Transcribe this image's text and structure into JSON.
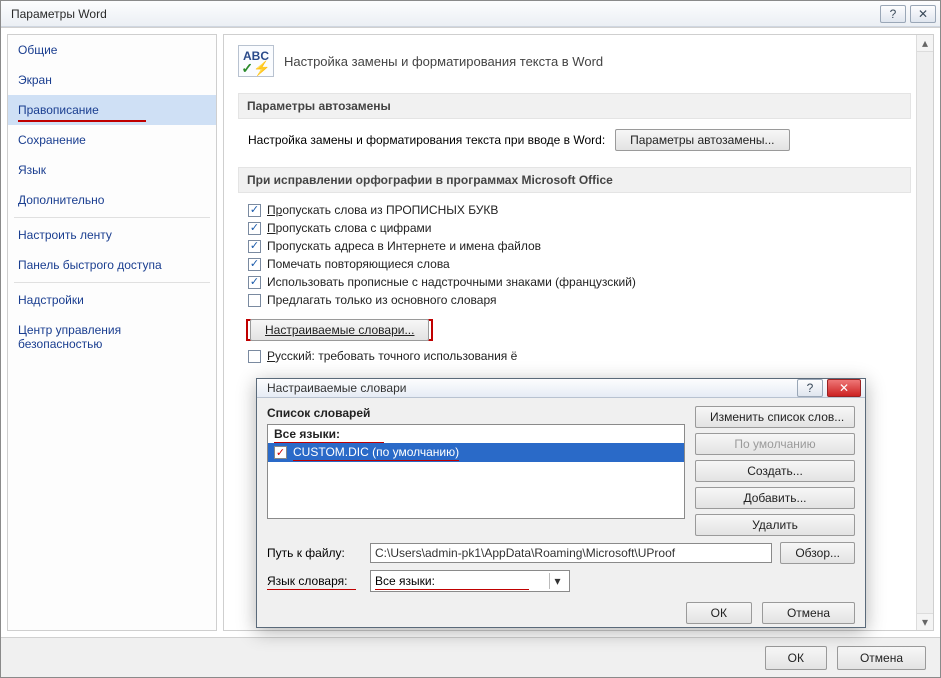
{
  "window": {
    "title": "Параметры Word"
  },
  "sidebar": {
    "items": [
      "Общие",
      "Экран",
      "Правописание",
      "Сохранение",
      "Язык",
      "Дополнительно",
      "Настроить ленту",
      "Панель быстрого доступа",
      "Надстройки",
      "Центр управления безопасностью"
    ],
    "selected_index": 2
  },
  "page": {
    "abc": "ABC",
    "heading": "Настройка замены и форматирования текста в Word",
    "group1_title": "Параметры автозамены",
    "autocorrect_label": "Настройка замены и форматирования текста при вводе в Word:",
    "autocorrect_button": "Параметры автозамены...",
    "group2_title": "При исправлении орфографии в программах Microsoft Office",
    "checks": [
      {
        "checked": true,
        "prefix": "Пр",
        "rest": "опускать слова из ПРОПИСНЫХ БУКВ"
      },
      {
        "checked": true,
        "prefix": "П",
        "rest": "ропускать слова с цифрами"
      },
      {
        "checked": true,
        "prefix": "",
        "rest": "Пропускать адреса в Интернете и имена файлов"
      },
      {
        "checked": true,
        "prefix": "",
        "rest": "Помечать повторяющиеся слова"
      },
      {
        "checked": true,
        "prefix": "",
        "rest": "Использовать прописные с надстрочными знаками (французский)"
      },
      {
        "checked": false,
        "prefix": "",
        "rest": "Предлагать только из основного словаря"
      }
    ],
    "custom_dict_button": "Настраиваемые словари...",
    "russian_yo": {
      "checked": false,
      "label": "Русский: требовать точного использования ё"
    }
  },
  "dialog": {
    "title": "Настраиваемые словари",
    "list_label": "Список словарей",
    "list_header": "Все языки:",
    "list_item_text": "CUSTOM.DIC (по умолчанию)",
    "buttons": {
      "edit": "Изменить список слов...",
      "default": "По умолчанию",
      "create": "Создать...",
      "add": "Добавить...",
      "delete": "Удалить"
    },
    "path_label": "Путь к файлу:",
    "path_value": "C:\\Users\\admin-pk1\\AppData\\Roaming\\Microsoft\\UProof",
    "browse": "Обзор...",
    "lang_label": "Язык словаря:",
    "lang_value": "Все языки:",
    "ok": "ОК",
    "cancel": "Отмена"
  },
  "footer": {
    "ok": "ОК",
    "cancel": "Отмена"
  }
}
